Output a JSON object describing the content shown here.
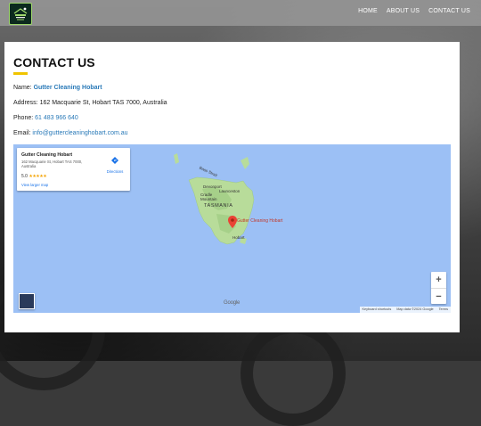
{
  "nav": {
    "home": "HOME",
    "about": "ABOUT US",
    "contact": "CONTACT US"
  },
  "header": {
    "logo_icon": "brand-logo"
  },
  "page": {
    "title": "CONTACT US",
    "name_label": "Name:",
    "name_value": "Gutter Cleaning Hobart",
    "address_label": "Address:",
    "address_value": "162 Macquarie St,  Hobart TAS 7000, Australia",
    "phone_label": "Phone:",
    "phone_value": "61 483 966 640",
    "email_label": "Email:",
    "email_value": "info@guttercleaninghobart.com.au"
  },
  "map": {
    "card_name": "Gutter Cleaning Hobart",
    "card_address": "162 Macquarie St, Hobart TAS 7000, Australia",
    "rating": "5.0",
    "stars": "★★★★★",
    "larger_map": "View larger map",
    "directions": "Directions",
    "pin_label": "Gutter Cleaning Hobart",
    "labels": {
      "tasmania": "TASMANIA",
      "devonport": "Devonport",
      "launceston": "Launceston",
      "cradle": "Cradle Mountain",
      "hobart": "Hobart",
      "king": "Bass Strait"
    },
    "zoom_in": "+",
    "zoom_out": "−",
    "google": "Google",
    "shortcuts": "Keyboard shortcuts",
    "mapdata": "Map data ©2024 Google",
    "terms": "Terms",
    "accent": "#1a73e8"
  }
}
